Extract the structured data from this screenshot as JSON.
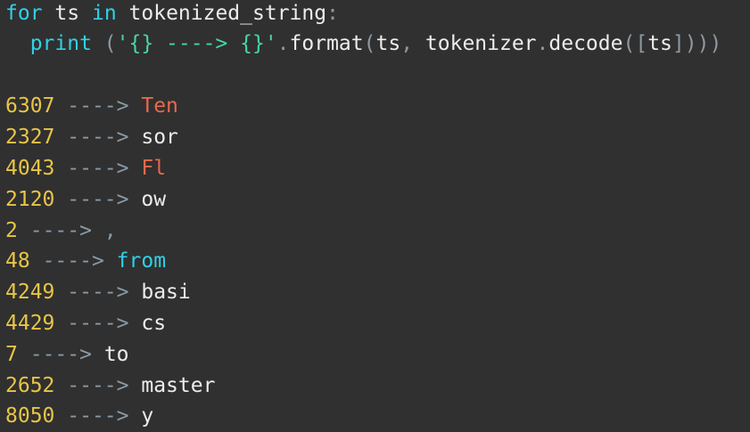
{
  "code": {
    "line1": {
      "kw_for": "for",
      "var": "ts",
      "kw_in": "in",
      "iterable": "tokenized_string",
      "colon": ":"
    },
    "line2": {
      "indent": "  ",
      "func": "print",
      "open_paren": " (",
      "string": "'{} ----> {}'",
      "dot1": ".",
      "method": "format",
      "open_paren2": "(",
      "arg1": "ts",
      "comma": ",",
      "obj": "tokenizer",
      "dot2": ".",
      "method2": "decode",
      "open_paren3": "(",
      "open_bracket": "[",
      "arg2": "ts",
      "close": "]))) "
    }
  },
  "output": [
    {
      "id": "6307",
      "arrow": "---->",
      "token": "Ten",
      "color": "#e5694f"
    },
    {
      "id": "2327",
      "arrow": "---->",
      "token": "sor",
      "color": "#ececec"
    },
    {
      "id": "4043",
      "arrow": "---->",
      "token": "Fl",
      "color": "#e5694f"
    },
    {
      "id": "2120",
      "arrow": "---->",
      "token": "ow",
      "color": "#ececec"
    },
    {
      "id": "2",
      "arrow": "---->",
      "token": ",",
      "color": "#8a9aa6"
    },
    {
      "id": "48",
      "arrow": "---->",
      "token": "from",
      "color": "#2fd1e8"
    },
    {
      "id": "4249",
      "arrow": "---->",
      "token": "basi",
      "color": "#ececec"
    },
    {
      "id": "4429",
      "arrow": "---->",
      "token": "cs",
      "color": "#ececec"
    },
    {
      "id": "7",
      "arrow": "---->",
      "token": "to",
      "color": "#ececec"
    },
    {
      "id": "2652",
      "arrow": "---->",
      "token": "master",
      "color": "#ececec"
    },
    {
      "id": "8050",
      "arrow": "---->",
      "token": "y",
      "color": "#ececec"
    }
  ]
}
